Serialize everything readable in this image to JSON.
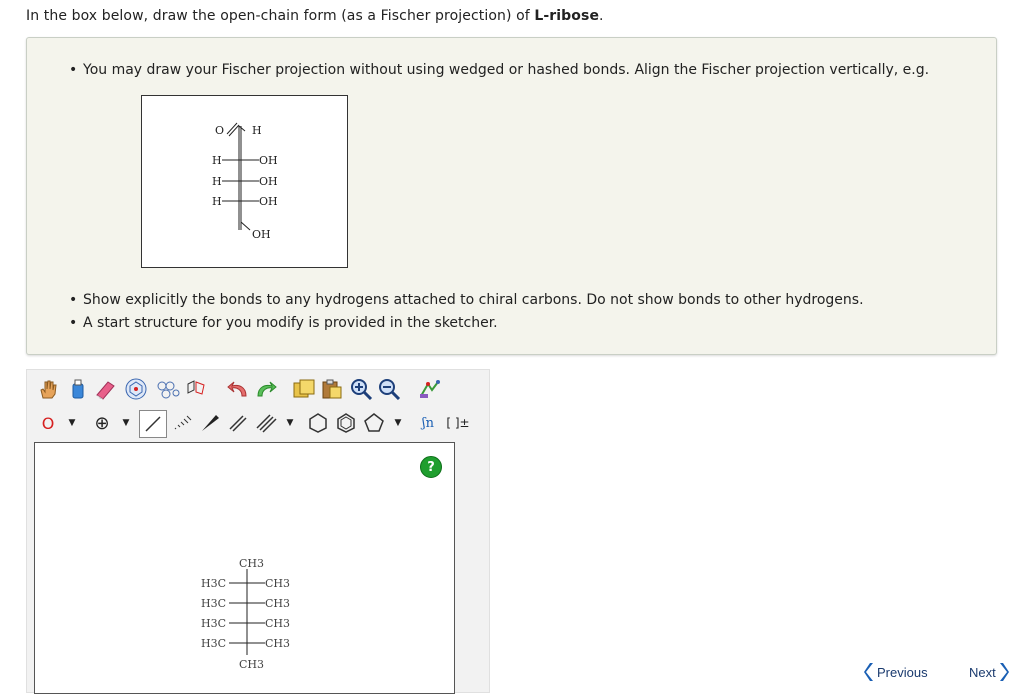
{
  "question": {
    "prefix": "In the box below, draw the open-chain form (as a Fischer projection) of ",
    "compound": "L-ribose",
    "suffix": "."
  },
  "instructions": [
    "You may draw your Fischer projection without using wedged or hashed bonds. Align the Fischer projection vertically, e.g.",
    "Show explicitly the bonds to any hydrogens attached to chiral carbons. Do not show bonds to other hydrogens.",
    "A start structure for you modify is provided in the sketcher."
  ],
  "example_structure": {
    "top_o": "O",
    "top_h": "H",
    "rows": [
      {
        "left": "H",
        "right": "OH"
      },
      {
        "left": "H",
        "right": "OH"
      },
      {
        "left": "H",
        "right": "OH"
      }
    ],
    "bottom": "OH"
  },
  "sketcher": {
    "atom_selector": "O",
    "charge_selector": "⊕",
    "help": "?",
    "extra_tools": [
      "ʃn",
      "[ ]±"
    ],
    "start_structure": {
      "top": "CH3",
      "rows": [
        {
          "left": "H3C",
          "right": "CH3"
        },
        {
          "left": "H3C",
          "right": "CH3"
        },
        {
          "left": "H3C",
          "right": "CH3"
        },
        {
          "left": "H3C",
          "right": "CH3"
        }
      ],
      "bottom": "CH3"
    }
  },
  "navigation": {
    "previous": "Previous",
    "next": "Next"
  },
  "colors": {
    "info_bg": "#f4f4ec",
    "help_green": "#1f9e2e",
    "nav_blue": "#1a5fb4",
    "atom_red": "#d62020"
  }
}
